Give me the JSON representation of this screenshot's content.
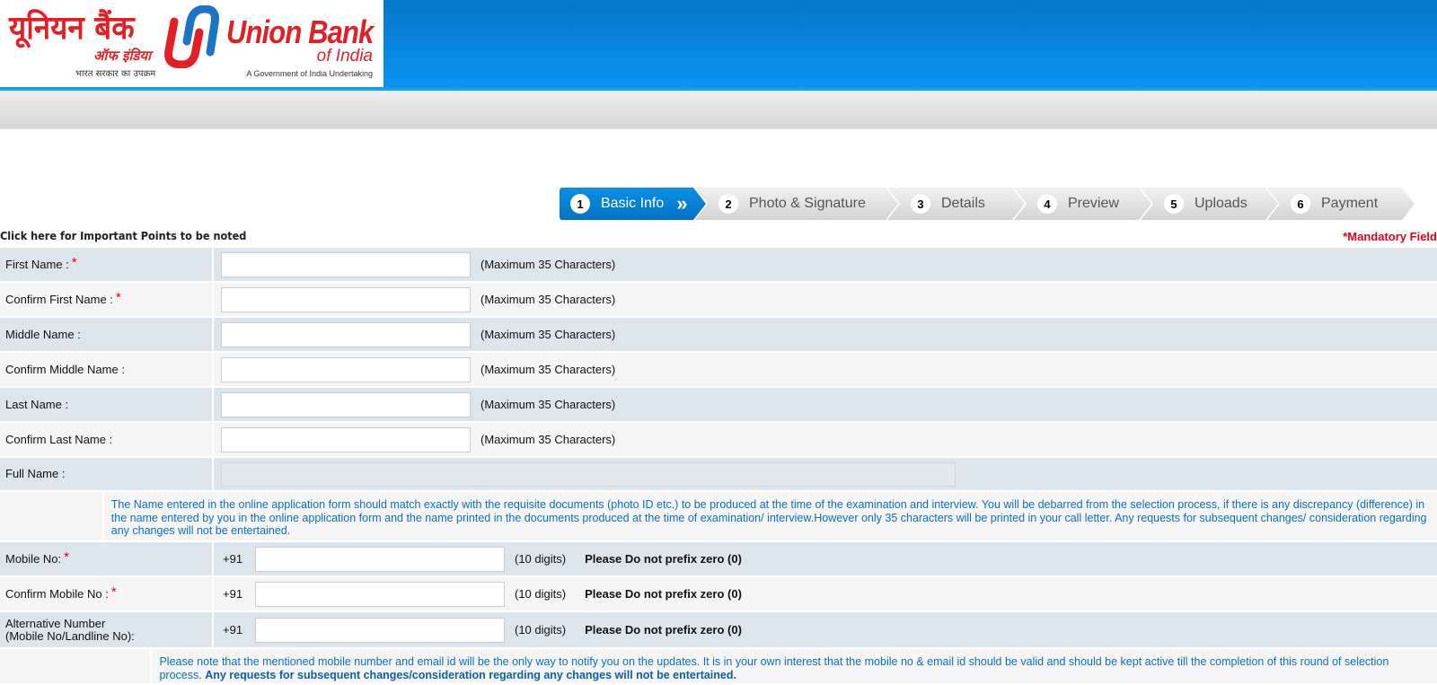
{
  "header": {
    "logo": {
      "hindi_name": "यूनियन बैंक",
      "hindi_sub": "ऑफ इंडिया",
      "hindi_tagline": "भारत सरकार का उपक्रम",
      "english_name": "Union Bank",
      "english_sub": "of India",
      "english_tagline": "A Government of India Undertaking",
      "colors": {
        "red": "#e31e25",
        "blue": "#1a75c4"
      }
    },
    "banner_color": "#0a8ee9"
  },
  "stepper": {
    "steps": [
      {
        "number": "1",
        "label": "Basic Info",
        "active": true
      },
      {
        "number": "2",
        "label": "Photo & Signature",
        "active": false
      },
      {
        "number": "3",
        "label": "Details",
        "active": false
      },
      {
        "number": "4",
        "label": "Preview",
        "active": false
      },
      {
        "number": "5",
        "label": "Uploads",
        "active": false
      },
      {
        "number": "6",
        "label": "Payment",
        "active": false
      }
    ],
    "active_chevron": "»"
  },
  "important_points_link": "Click here for Important Points to be noted",
  "mandatory_note": "*Mandatory Field",
  "form": {
    "required_marker": "*",
    "max_hint": "(Maximum 35 Characters)",
    "name_fields": [
      {
        "label": "First Name : ",
        "required": true,
        "value": ""
      },
      {
        "label": "Confirm First Name : ",
        "required": true,
        "value": ""
      },
      {
        "label": "Middle Name :",
        "required": false,
        "value": ""
      },
      {
        "label": "Confirm Middle Name :",
        "required": false,
        "value": ""
      },
      {
        "label": "Last Name :",
        "required": false,
        "value": ""
      },
      {
        "label": "Confirm Last Name :",
        "required": false,
        "value": ""
      }
    ],
    "full_name": {
      "label": "Full Name :",
      "value": ""
    },
    "name_note": "The Name entered in the online application form should match exactly with the requisite documents (photo ID etc.) to be produced at the time of the examination and interview. You will be debarred from the selection process, if there is any discrepancy (difference) in the name entered by you in the online application form and the name printed in the documents produced at the time of examination/ interview.However only 35 characters will be printed in your call letter. Any requests for subsequent changes/ consideration regarding any changes will not be entertained.",
    "country_code": "+91",
    "digits_hint": "(10 digits)",
    "no_zero_hint": "Please Do not prefix zero (0)",
    "mobile_fields": [
      {
        "label": "Mobile No:",
        "required": true,
        "value": ""
      },
      {
        "label": "Confirm Mobile No :",
        "required": true,
        "value": ""
      },
      {
        "label_line1": "Alternative Number",
        "label_line2": "(Mobile No/Landline No):",
        "required": false,
        "value": ""
      }
    ],
    "mobile_note": "Please note that the mentioned mobile number and email id will be the only way to notify you on the updates. It is in your own interest that the mobile no & email id should be valid and should be kept active till the completion of this round of selection process. ",
    "mobile_note_bold": "Any requests for subsequent changes/consideration regarding any changes will not be entertained."
  }
}
